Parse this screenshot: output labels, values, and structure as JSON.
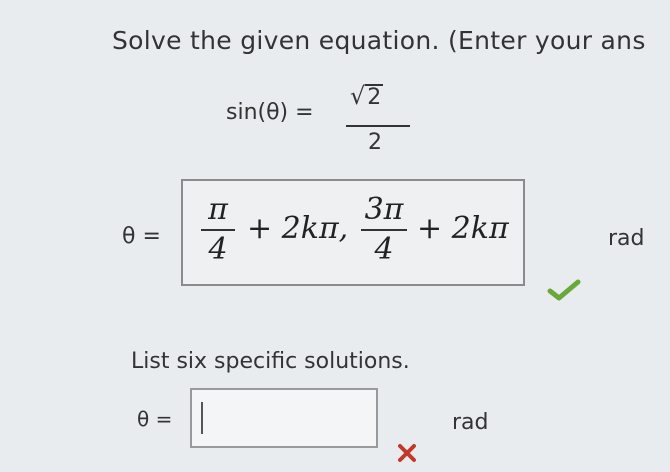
{
  "instruction": "Solve the given equation. (Enter your ans",
  "equation": {
    "lhs": "sin(θ) =",
    "numerator_radical": "√",
    "numerator_radicand": "2",
    "denominator": "2"
  },
  "answer1": {
    "label": "θ =",
    "frac1_num": "π",
    "frac1_den": "4",
    "term1": "+ 2kπ,",
    "frac2_num": "3π",
    "frac2_den": "4",
    "term2": "+ 2kπ",
    "unit": "rad",
    "status": "correct",
    "status_icon": "check-icon",
    "status_color": "#6aa83b"
  },
  "prompt": "List six specific solutions.",
  "answer2": {
    "label": "θ =",
    "value": "",
    "unit": "rad",
    "status": "incorrect",
    "status_icon": "x-icon",
    "status_color": "#c0392b"
  }
}
